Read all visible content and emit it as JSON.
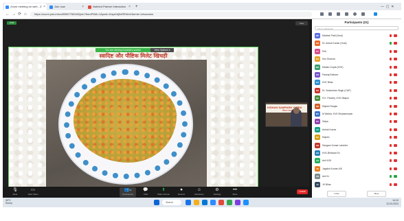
{
  "browser": {
    "tabs": [
      {
        "label": "Zoom meeting on web - Z",
        "color": "#2d8cff"
      },
      {
        "label": "Join now",
        "color": "#2d8cff"
      },
      {
        "label": "Nutrient Partner Interaction",
        "color": "#e04b3c"
      }
    ],
    "new_tab": "+",
    "url": "https://zoom.pds.in/wc/83567768162/join?fromPWA=1&pwd=Zzqa2dj0xRENmV&emb=1#success",
    "nav": {
      "back": "←",
      "forward": "→",
      "reload": "⟳",
      "home": "⌂"
    }
  },
  "meeting": {
    "badge": "LIVE",
    "view_button": "View",
    "share_banner": "You are viewing Kaushal's screen",
    "view_options": "View Options ▾",
    "slide_title": "स्वादिष्ट और पौष्टिक मिलेट खिचड़ी",
    "side_cam": {
      "line1": "KISHAN SAMPARK YATRA",
      "line2": "किसान सम्पर्क"
    }
  },
  "toolbar": {
    "buttons": [
      {
        "glyph": "🎙",
        "label": "Mute"
      },
      {
        "glyph": "▭",
        "label": "Start Video"
      },
      {
        "glyph": "👥",
        "label": "Participants",
        "count": "21"
      },
      {
        "glyph": "💬",
        "label": "Chat"
      },
      {
        "glyph": "⬆",
        "label": "Share Screen"
      },
      {
        "glyph": "⏺",
        "label": "Record"
      },
      {
        "glyph": "☺",
        "label": "Reactions"
      },
      {
        "glyph": "⚙",
        "label": "Settings"
      },
      {
        "glyph": "•••",
        "label": "More"
      }
    ],
    "end": "Leave"
  },
  "participants": {
    "title": "Participants (21)",
    "search_placeholder": "Find a participant",
    "list": [
      {
        "initials": "MP",
        "name": "Mahesh Patil (Host)",
        "color": "#5b6ee1",
        "mic": false,
        "video": false
      },
      {
        "initials": "DR",
        "name": "Dr. Ashok Kumar (Host)",
        "color": "#e86a2c",
        "mic": true,
        "video": false
      },
      {
        "initials": "PT",
        "name": "Priti",
        "color": "#d94c8a",
        "mic": false,
        "video": false
      },
      {
        "initials": "KS",
        "name": "Kris Sharma",
        "color": "#e8a22a",
        "mic": false,
        "video": false
      },
      {
        "initials": "MG",
        "name": "Madan Gupta (KVK)",
        "color": "#3aa06d",
        "mic": false,
        "video": false
      },
      {
        "initials": "PR",
        "name": "Pankaj Rathore",
        "color": "#7a56c9",
        "mic": false,
        "video": false
      },
      {
        "initials": "KV",
        "name": "KVK Bihar",
        "color": "#2f8fd1",
        "mic": false,
        "video": false
      },
      {
        "initials": "DS",
        "name": "Dr. Sudarshan Singh (CAP)",
        "color": "#c8372d",
        "mic": false,
        "video": false
      },
      {
        "initials": "SK",
        "name": "S.K. Pandey, KVK-Sitapur",
        "color": "#4a8f3b",
        "mic": false,
        "video": false
      },
      {
        "initials": "RR",
        "name": "Rajesh Ranjan",
        "color": "#d35f28",
        "mic": false,
        "video": false
      },
      {
        "initials": "MV",
        "name": "M Mishra, KVK Bhubaneswar",
        "color": "#3b74c7",
        "mic": false,
        "video": false
      },
      {
        "initials": "SV",
        "name": "Satya",
        "color": "#8e44ad",
        "mic": false,
        "video": false
      },
      {
        "initials": "AV",
        "name": "Ashok Kumar",
        "color": "#16a085",
        "mic": false,
        "video": false
      },
      {
        "initials": "RA",
        "name": "Rajesh",
        "color": "#d4a017",
        "mic": false,
        "video": false
      },
      {
        "initials": "SN",
        "name": "Sangam Kumar Lakshmi",
        "color": "#c0392b",
        "mic": false,
        "video": false
      },
      {
        "initials": "KB",
        "name": "KVK-Bhilwara Ex",
        "color": "#2980b9",
        "mic": false,
        "video": false
      },
      {
        "initials": "AS",
        "name": "Anil KVK",
        "color": "#27ae60",
        "mic": false,
        "video": false
      },
      {
        "initials": "JK",
        "name": "Jagdish Kumar IAS",
        "color": "#e67e22",
        "mic": false,
        "video": false
      },
      {
        "initials": "AN",
        "name": "Anil Kr",
        "color": "#7f8c8d",
        "mic": true,
        "video": true
      },
      {
        "initials": "JV",
        "name": "JK Bihar",
        "color": "#34495e",
        "mic": false,
        "video": false
      }
    ],
    "invite": "Invite",
    "more": "More"
  },
  "taskbar": {
    "weather_temp": "30°C",
    "weather_desc": "Sunny",
    "search": "Search",
    "apps": [
      "#1a73e8",
      "#f2b01e",
      "#0078d4",
      "#2d8cff",
      "#e04b3c",
      "#34a853",
      "#7b3fe4",
      "#1e90ff"
    ],
    "time": "14:24",
    "date": "12-03-2024"
  }
}
